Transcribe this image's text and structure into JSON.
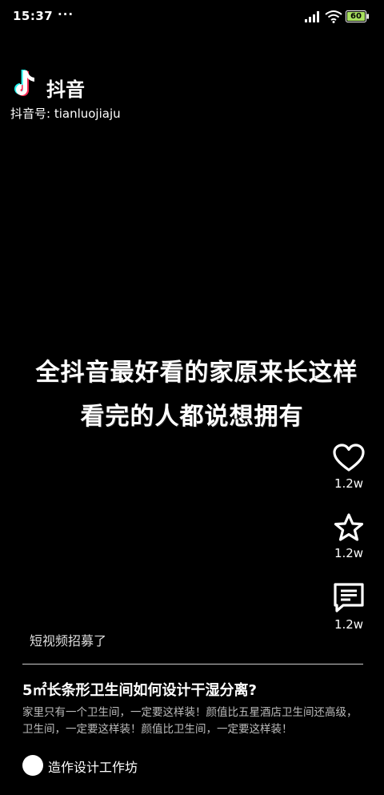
{
  "status_bar": {
    "time": "15:37",
    "dots": "···",
    "battery_level": "60"
  },
  "app": {
    "name": "抖音",
    "account_id": "抖音号: tianluojiaju"
  },
  "video": {
    "headline_line1": "全抖音最好看的家原来长这样",
    "headline_line2": "看完的人都说想拥有",
    "title": "5㎡长条形卫生间如何设计干湿分离?",
    "description": "家里只有一个卫生间，一定要这样装！颜值比五星酒店卫生间还高级，卫生间，一定要这样装！颜值比卫生间，一定要这样装！"
  },
  "actions": {
    "like_count": "1.2w",
    "favorite_count": "1.2w",
    "comment_count": "1.2w"
  },
  "recruit_text": "短视频招募了",
  "author": {
    "name": "造作设计工作坊"
  },
  "icons": [
    "tiktok-logo-icon",
    "signal-icon",
    "wifi-icon",
    "battery-icon",
    "heart-icon",
    "star-icon",
    "comment-icon"
  ]
}
